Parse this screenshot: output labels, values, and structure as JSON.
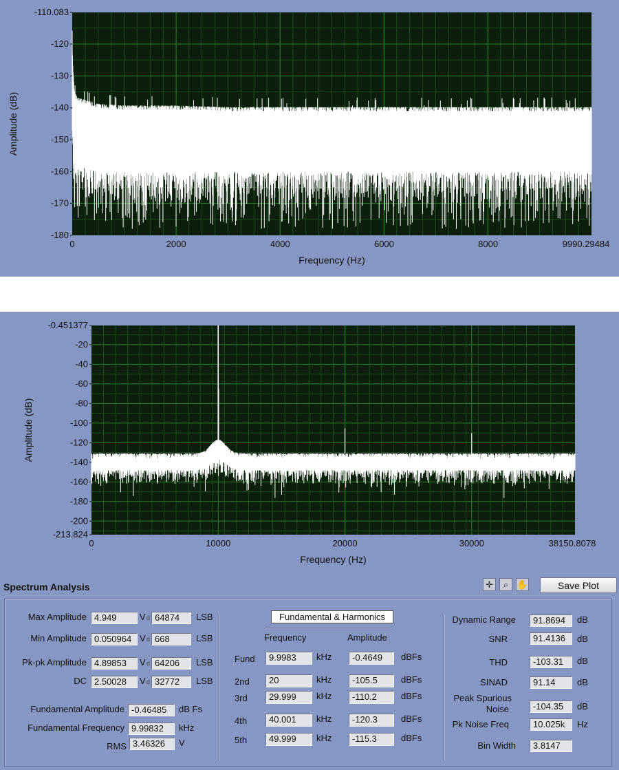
{
  "chart_data": [
    {
      "type": "line",
      "title": "",
      "xlabel": "Frequency (Hz)",
      "ylabel": "Amplitude (dB)",
      "xlim": [
        0,
        9990.29484
      ],
      "ylim": [
        -180,
        -110.083
      ],
      "x_ticks": [
        "0",
        "2000",
        "4000",
        "6000",
        "8000",
        "9990.29484"
      ],
      "y_ticks": [
        "-110.083",
        "-120",
        "-130",
        "-140",
        "-150",
        "-160",
        "-170",
        "-180"
      ],
      "grid": true,
      "background": "#0c1f0c",
      "grid_color": "#2b7d2b",
      "trace_color": "#ffffff",
      "series": [
        {
          "x": [
            0,
            15,
            40,
            100,
            500,
            1000,
            2000,
            3000,
            4000,
            5000,
            6000,
            7000,
            8000,
            9000,
            9990
          ],
          "upper": [
            -117,
            -128,
            -136,
            -138,
            -140,
            -140.5,
            -140.5,
            -141,
            -141,
            -141,
            -141,
            -141,
            -141,
            -141,
            -141
          ],
          "lower": [
            -147,
            -152,
            -155,
            -158,
            -160,
            -160,
            -160,
            -160,
            -160,
            -160,
            -160,
            -160,
            -160,
            -160,
            -160
          ],
          "min_envelope": [
            -150,
            -170,
            -176,
            -178,
            -178,
            -178,
            -178,
            -178,
            -178,
            -178,
            -178,
            -178,
            -178,
            -178,
            -178
          ]
        }
      ]
    },
    {
      "type": "line",
      "title": "",
      "xlabel": "Frequency (Hz)",
      "ylabel": "Amplitude (dB)",
      "xlim": [
        0,
        38150.8078
      ],
      "ylim": [
        -213.824,
        -0.451377
      ],
      "x_ticks": [
        "0",
        "10000",
        "20000",
        "30000",
        "38150.8078"
      ],
      "y_ticks": [
        "-0.451377",
        "-20",
        "-40",
        "-60",
        "-80",
        "-100",
        "-120",
        "-140",
        "-160",
        "-180",
        "-200",
        "-213.824"
      ],
      "grid": true,
      "background": "#0c1f0c",
      "grid_color": "#2b7d2b",
      "trace_color": "#ffffff",
      "series": [
        {
          "noise_upper": -133,
          "noise_lower": -148,
          "peaks": [
            {
              "x": 9998.3,
              "y": -0.4649
            },
            {
              "x": 20000,
              "y": -105.5
            },
            {
              "x": 29999,
              "y": -110.2
            }
          ]
        }
      ]
    }
  ],
  "analysis": {
    "title": "Spectrum  Analysis",
    "save_label": "Save Plot",
    "tools": {
      "cursor": "crosshair-icon",
      "zoom": "zoom-icon",
      "pan": "hand-icon"
    },
    "left": [
      {
        "label": "Max Amplitude",
        "v": "4.949",
        "v_unit": "V",
        "lsb": "64874",
        "lsb_unit": "LSB"
      },
      {
        "label": "Min Amplitude",
        "v": "0.050964",
        "v_unit": "V",
        "lsb": "668",
        "lsb_unit": "LSB"
      },
      {
        "label": "Pk-pk Amplitude",
        "v": "4.89853",
        "v_unit": "V",
        "lsb": "64206",
        "lsb_unit": "LSB"
      },
      {
        "label": "DC",
        "v": "2.50028",
        "v_unit": "V",
        "lsb": "32772",
        "lsb_unit": "LSB"
      }
    ],
    "fund_amp": {
      "label": "Fundamental Amplitude",
      "value": "-0.46485",
      "unit": "dB Fs"
    },
    "fund_freq": {
      "label": "Fundamental Frequency",
      "value": "9.99832",
      "unit": "kHz"
    },
    "rms": {
      "label": "RMS",
      "value": "3.46326",
      "unit": "V"
    },
    "harmonics": {
      "title": "Fundamental & Harmonics",
      "freq_header": "Frequency",
      "amp_header": "Amplitude",
      "freq_unit": "kHz",
      "amp_unit": "dBFs",
      "rows": [
        {
          "label": "Fund",
          "freq": "9.9983",
          "amp": "-0.4649"
        },
        {
          "label": "2nd",
          "freq": "20",
          "amp": "-105.5"
        },
        {
          "label": "3rd",
          "freq": "29.999",
          "amp": "-110.2"
        },
        {
          "label": "4th",
          "freq": "40.001",
          "amp": "-120.3"
        },
        {
          "label": "5th",
          "freq": "49.999",
          "amp": "-115.3"
        }
      ]
    },
    "right": {
      "dynamic_range": {
        "label": "Dynamic Range",
        "value": "91.8694",
        "unit": "dB"
      },
      "snr": {
        "label": "SNR",
        "value": "91.4136",
        "unit": "dB"
      },
      "thd": {
        "label": "THD",
        "value": "-103.31",
        "unit": "dB"
      },
      "sinad": {
        "label": "SINAD",
        "value": "91.14",
        "unit": "dB"
      },
      "peak_spurious": {
        "label1": "Peak Spurious",
        "label2": "Noise",
        "value": "-104.35",
        "unit": "dB"
      },
      "pk_noise_freq": {
        "label": "Pk Noise Freq",
        "value": "10.025k",
        "unit": "Hz"
      },
      "bin_width": {
        "label": "Bin Width",
        "value": "3.8147"
      }
    }
  }
}
